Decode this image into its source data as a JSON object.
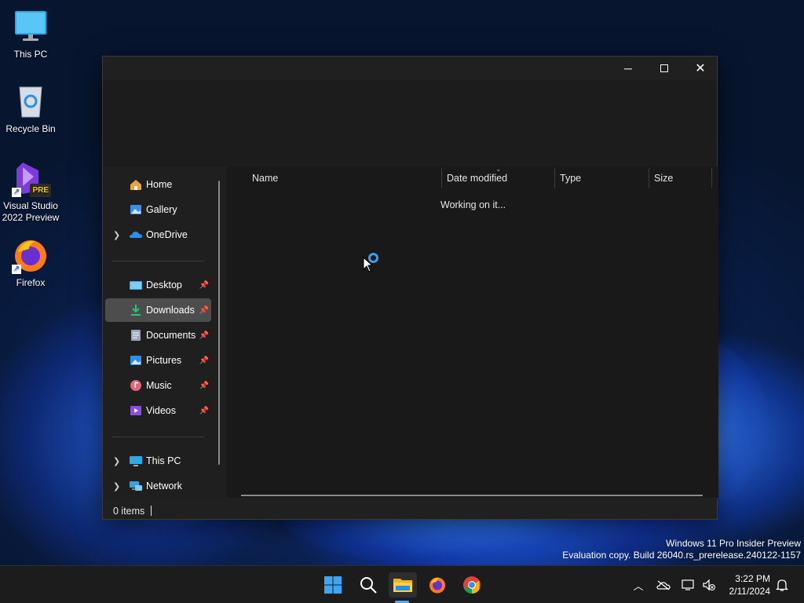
{
  "desktop": {
    "icons": [
      {
        "label": "This PC"
      },
      {
        "label": "Recycle Bin"
      },
      {
        "label": "Visual Studio 2022 Preview",
        "badge": "PRE"
      },
      {
        "label": "Firefox"
      }
    ]
  },
  "explorer": {
    "nav": {
      "items": [
        {
          "label": "Home",
          "icon": "home-icon"
        },
        {
          "label": "Gallery",
          "icon": "gallery-icon"
        },
        {
          "label": "OneDrive",
          "icon": "onedrive-icon"
        },
        {
          "label": "Desktop",
          "icon": "desktop-folder-icon",
          "pinned": true
        },
        {
          "label": "Downloads",
          "icon": "downloads-folder-icon",
          "pinned": true,
          "selected": true
        },
        {
          "label": "Documents",
          "icon": "documents-folder-icon",
          "pinned": true
        },
        {
          "label": "Pictures",
          "icon": "pictures-folder-icon",
          "pinned": true
        },
        {
          "label": "Music",
          "icon": "music-folder-icon",
          "pinned": true
        },
        {
          "label": "Videos",
          "icon": "videos-folder-icon",
          "pinned": true
        },
        {
          "label": "This PC",
          "icon": "this-pc-icon"
        },
        {
          "label": "Network",
          "icon": "network-icon"
        }
      ]
    },
    "columns": {
      "name": "Name",
      "date_modified": "Date modified",
      "type": "Type",
      "size": "Size"
    },
    "status_message": "Working on it...",
    "status_bar": {
      "items_count": "0 items"
    }
  },
  "watermark": {
    "line1": "Windows 11 Pro Insider Preview",
    "line2": "Evaluation copy. Build 26040.rs_prerelease.240122-1157"
  },
  "taskbar": {
    "apps": [
      "start",
      "search",
      "file-explorer",
      "firefox",
      "chrome"
    ],
    "clock": {
      "time": "3:22 PM",
      "date": "2/11/2024"
    }
  },
  "colors": {
    "accent": "#3b9cf0",
    "window_bg": "#202020",
    "selected_nav": "#4d4d4d"
  }
}
